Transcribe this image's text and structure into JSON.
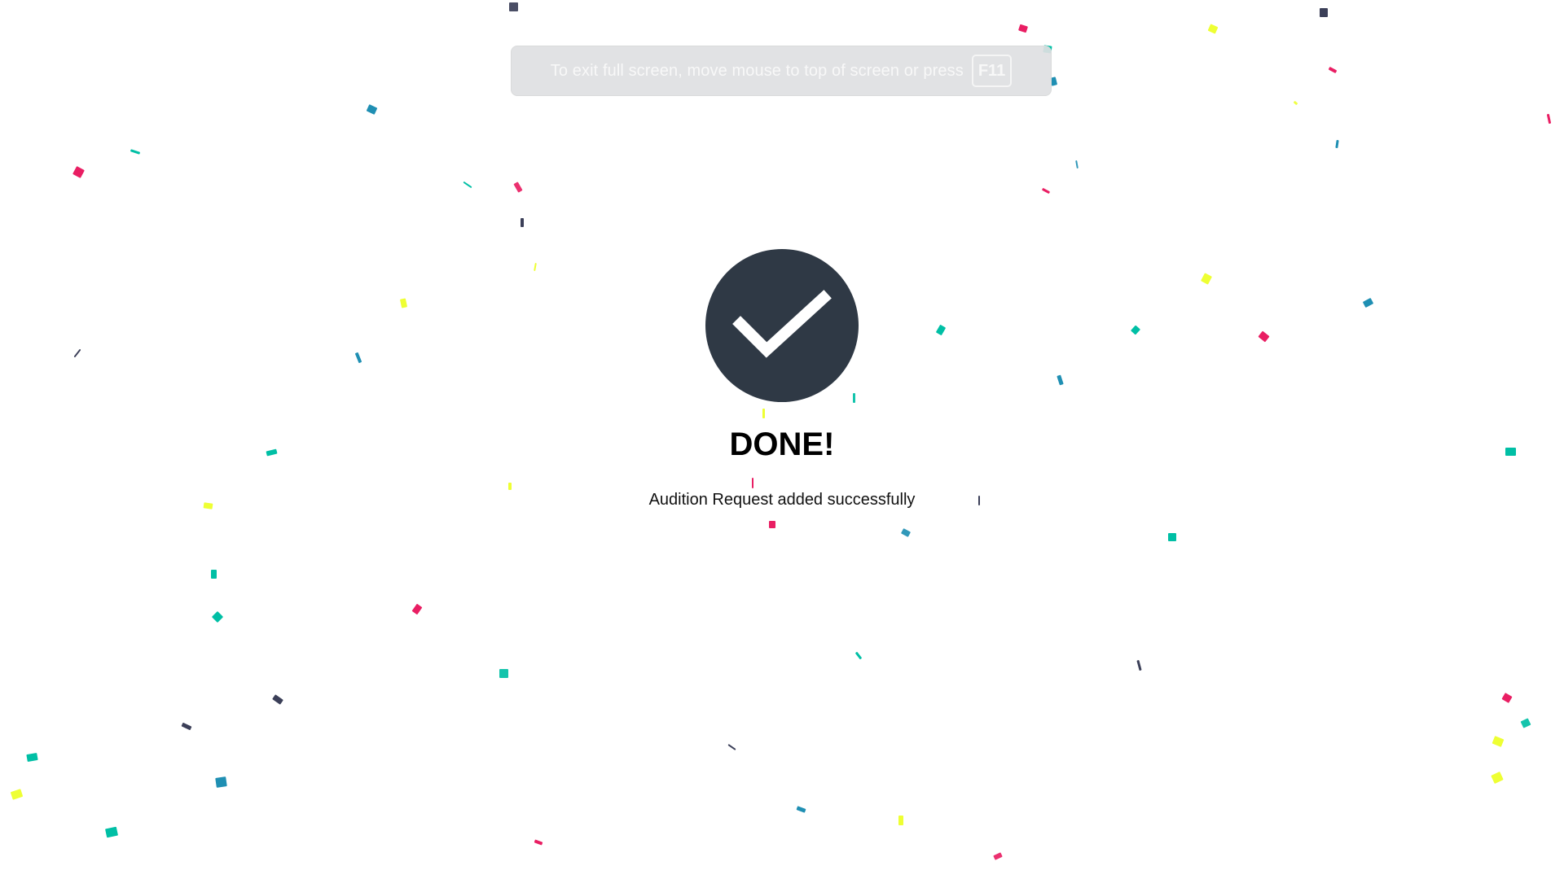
{
  "fullscreen_notice": {
    "text": "To exit full screen, move mouse to top of screen or press",
    "key": "F11"
  },
  "success": {
    "icon": "checkmark-icon",
    "title": "DONE!",
    "message": "Audition Request added successfully"
  },
  "colors": {
    "background": "#ffffff",
    "check_circle": "#2f3945",
    "confetti_pink": "#e91e63",
    "confetti_teal": "#00bfa5",
    "confetti_yellow": "#eeff33",
    "confetti_blue": "#1f8fb3",
    "confetti_navy": "#3b3f58"
  }
}
